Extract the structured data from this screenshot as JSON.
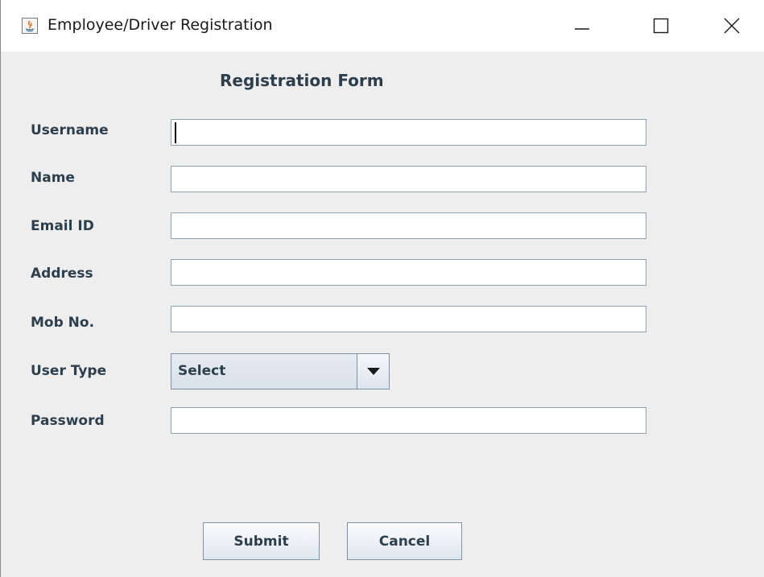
{
  "window": {
    "title": "Employee/Driver Registration",
    "icon": "java-icon",
    "controls": [
      "minimize-icon",
      "maximize-icon",
      "close-icon"
    ]
  },
  "form": {
    "title": "Registration Form",
    "fields": {
      "username": {
        "label": "Username",
        "value": ""
      },
      "name": {
        "label": "Name",
        "value": ""
      },
      "email": {
        "label": "Email ID",
        "value": ""
      },
      "address": {
        "label": "Address",
        "value": ""
      },
      "mobile": {
        "label": "Mob No.",
        "value": ""
      },
      "user_type": {
        "label": "User Type",
        "selected": "Select"
      },
      "password": {
        "label": "Password",
        "value": ""
      }
    },
    "buttons": {
      "submit": "Submit",
      "cancel": "Cancel"
    }
  }
}
